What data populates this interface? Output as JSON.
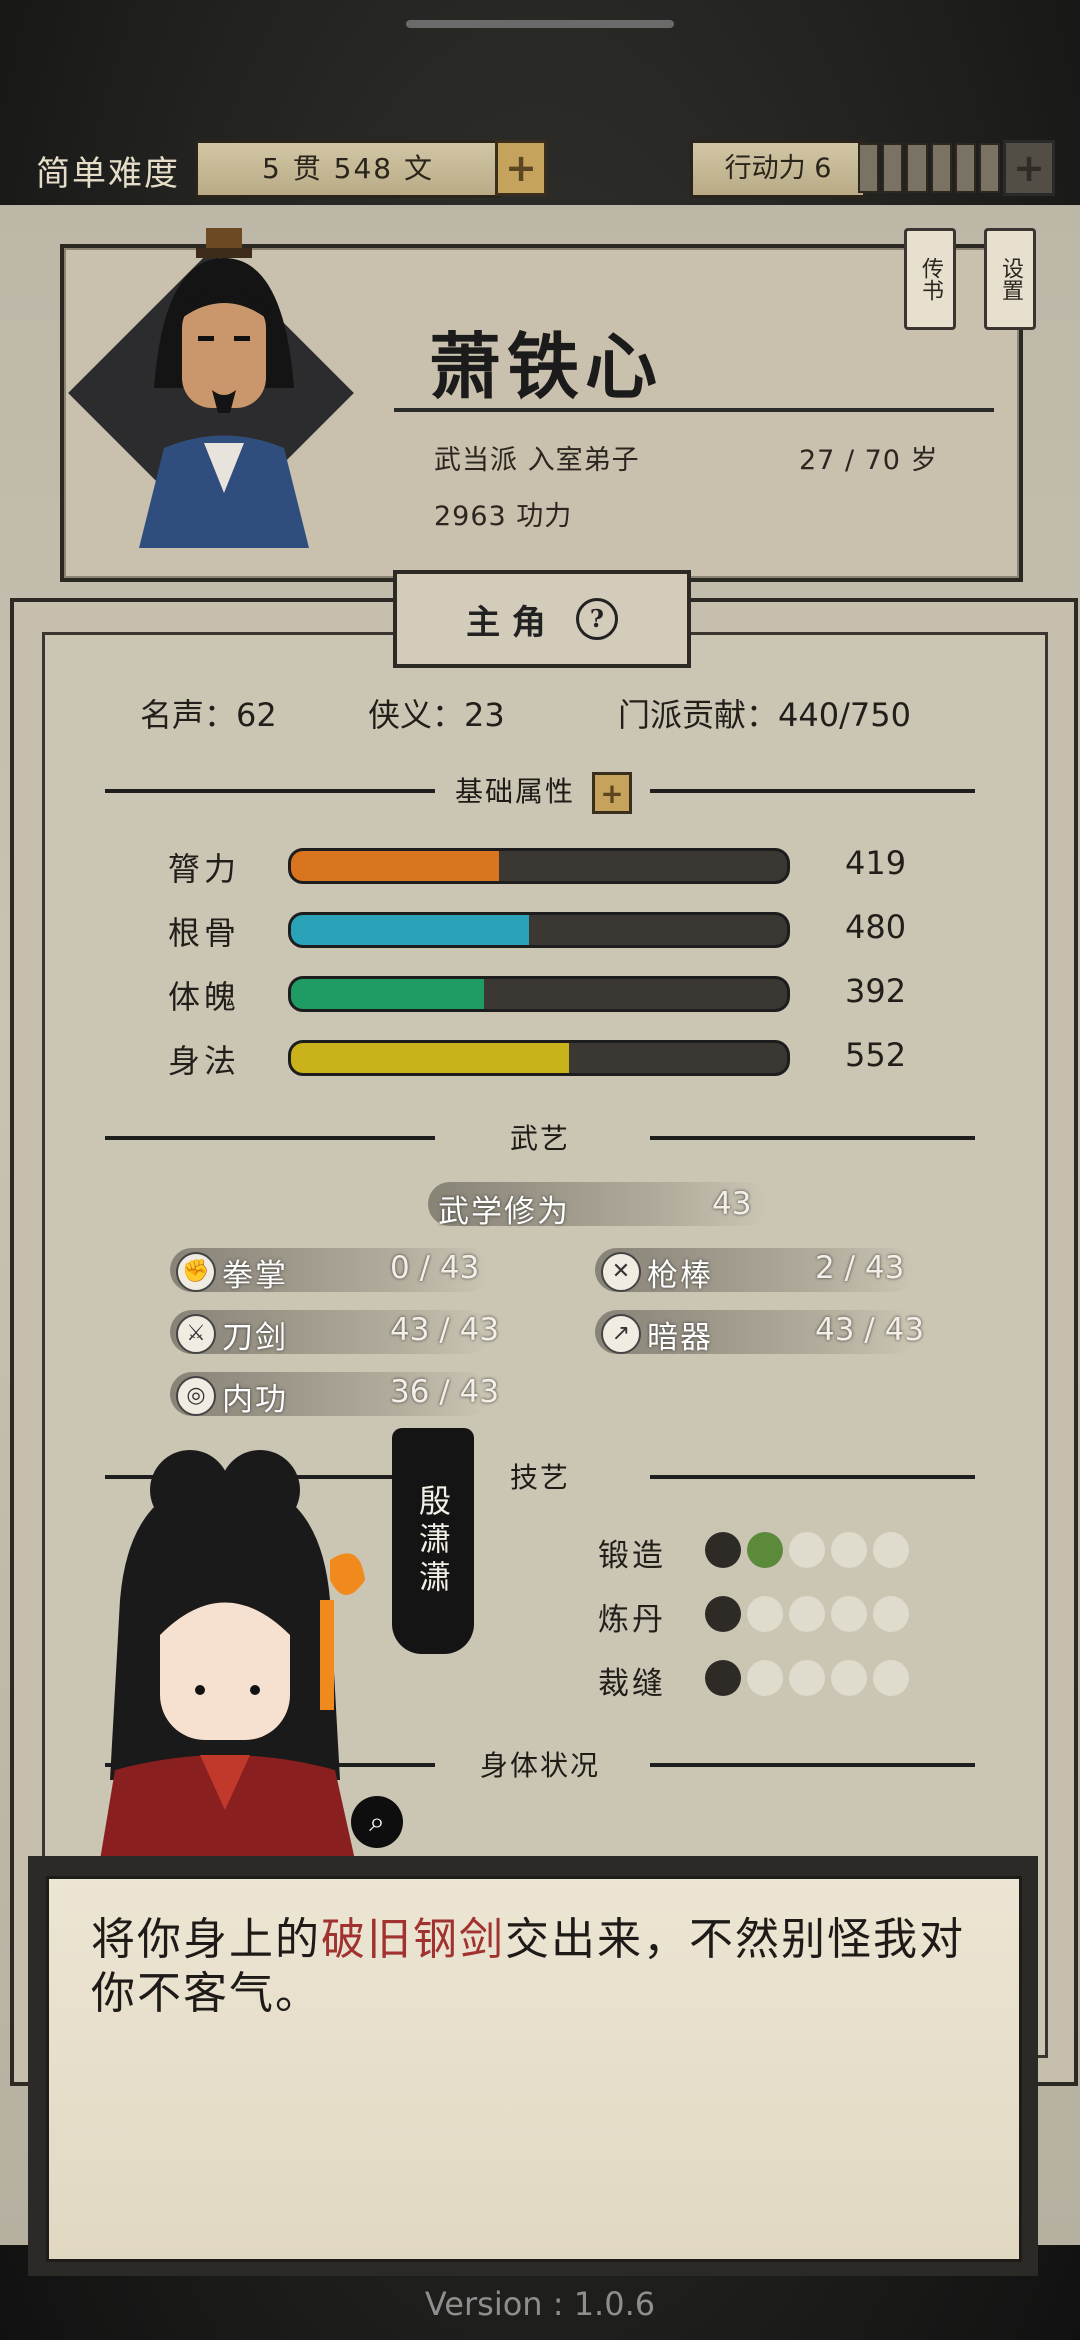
{
  "topbar": {
    "difficulty": "简单难度",
    "money": "5 贯  548  文",
    "action_points": "行动力 6",
    "plus_icon": "plus-icon"
  },
  "profile": {
    "name": "萧铁心",
    "sect": "武当派 入室弟子",
    "age": "27 / 70 岁",
    "power": "2963 功力",
    "tag_letters": "传书",
    "tag_settings": "设置"
  },
  "panel": {
    "tab_label": "主 角",
    "fame": "名声：62",
    "chivalry": "侠义：23",
    "contribution": "门派贡献：440/750"
  },
  "attributes": {
    "title": "基础属性",
    "items": [
      {
        "label": "膂力",
        "value": "419",
        "fill": 0.42,
        "color": "#d9741f"
      },
      {
        "label": "根骨",
        "value": "480",
        "fill": 0.48,
        "color": "#2aa3b8"
      },
      {
        "label": "体魄",
        "value": "392",
        "fill": 0.39,
        "color": "#1e9c63"
      },
      {
        "label": "身法",
        "value": "552",
        "fill": 0.56,
        "color": "#c9b21a"
      }
    ]
  },
  "martial": {
    "title": "武艺",
    "cultivation_label": "武学修为",
    "cultivation_value": "43",
    "skills": [
      {
        "label": "拳掌",
        "value": "0 / 43",
        "icon": "fist-icon"
      },
      {
        "label": "枪棒",
        "value": "2 / 43",
        "icon": "spear-icon"
      },
      {
        "label": "刀剑",
        "value": "43 / 43",
        "icon": "sword-icon"
      },
      {
        "label": "暗器",
        "value": "43 / 43",
        "icon": "dart-icon"
      },
      {
        "label": "内功",
        "value": "36 / 43",
        "icon": "inner-power-icon"
      }
    ]
  },
  "crafts": {
    "title": "技艺",
    "items": [
      {
        "label": "锻造",
        "level": 2,
        "max": 5
      },
      {
        "label": "炼丹",
        "level": 1,
        "max": 5
      },
      {
        "label": "裁缝",
        "level": 1,
        "max": 5
      }
    ]
  },
  "body_status_title": "身体状况",
  "npc": {
    "name": "殷潇潇",
    "dialog_before": "将你身上的",
    "dialog_highlight": "破旧钢剑",
    "dialog_after": "交出来，不然别怪我对你不客气。"
  },
  "version": "Version : 1.0.6",
  "colors": {
    "accent_gold": "#c6a35c",
    "highlight_red": "#a0322f"
  }
}
